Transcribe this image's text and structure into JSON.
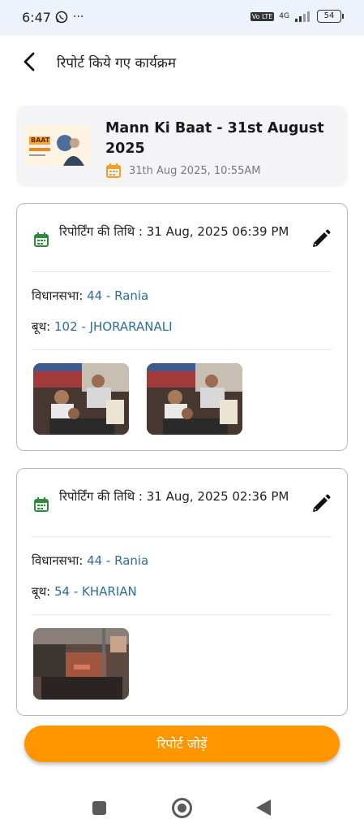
{
  "status_bar": {
    "time": "6:47",
    "more": "···",
    "volte": "Vo LTE",
    "network": "4G",
    "battery": "54"
  },
  "header": {
    "title": "रिपोर्ट किये गए कार्यक्रम"
  },
  "event": {
    "title": "Mann Ki Baat - 31st August 2025",
    "datetime": "31th Aug 2025, 10:55AM",
    "thumb_text": "BAAT"
  },
  "reports": [
    {
      "date_label": "रिपोर्टिंग की तिथि : 31 Aug, 2025 06:39 PM",
      "vidhansabha_label": "विधानसभा: ",
      "vidhansabha_value": "44 - Rania",
      "booth_label": "बूथ: ",
      "booth_value": "102 - JHORARANALI"
    },
    {
      "date_label": "रिपोर्टिंग की तिथि : 31 Aug, 2025 02:36 PM",
      "vidhansabha_label": "विधानसभा: ",
      "vidhansabha_value": "44 - Rania",
      "booth_label": "बूथ: ",
      "booth_value": "54 - KHARIAN"
    }
  ],
  "add_button": {
    "label": "रिपोर्ट जोड़ें"
  },
  "colors": {
    "accent": "#ff9600",
    "value_text": "#2f6e93",
    "calendar_green": "#2e8b3e",
    "calendar_orange": "#f0a020"
  }
}
